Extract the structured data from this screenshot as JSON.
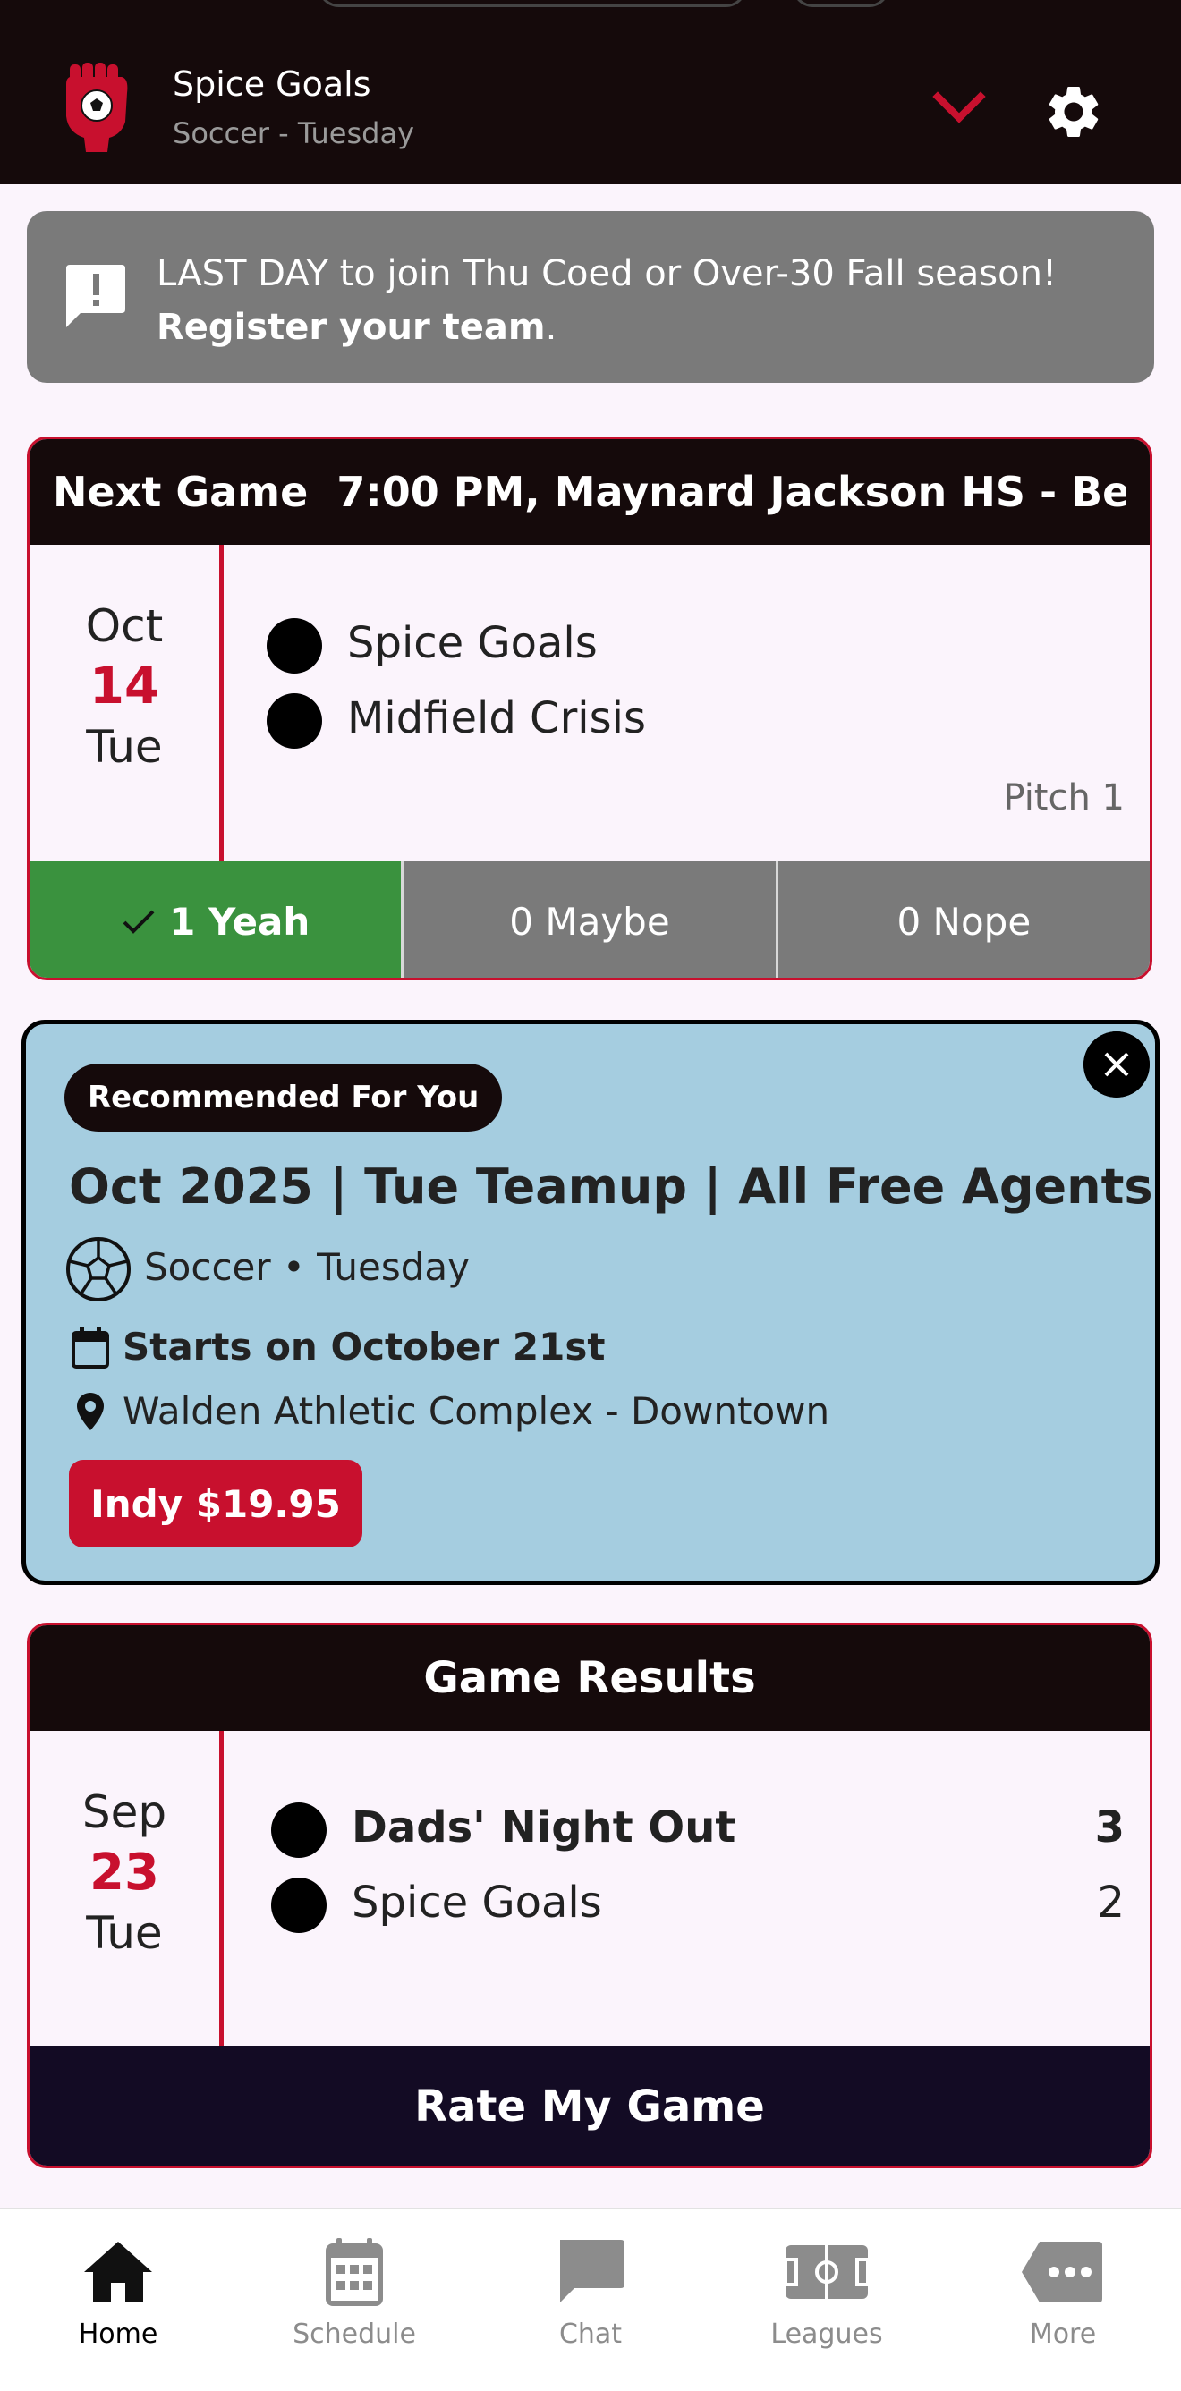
{
  "header": {
    "team_name": "Spice Goals",
    "team_subtitle": "Soccer - Tuesday",
    "logo": "red-fist-soccer-logo",
    "accent_color": "#c8102e"
  },
  "announcement": {
    "text": "LAST DAY to join Thu Coed or Over-30 Fall season! ",
    "link_text": "Register your team",
    "suffix": "."
  },
  "next_game": {
    "label": "Next Game",
    "details": "7:00 PM, Maynard Jackson HS - Be...",
    "month": "Oct",
    "day": "14",
    "weekday": "Tue",
    "teams": [
      "Spice Goals",
      "Midfield Crisis"
    ],
    "pitch": "Pitch 1",
    "rsvp": {
      "yes": "1 Yeah",
      "maybe": "0 Maybe",
      "no": "0 Nope"
    }
  },
  "recommended": {
    "badge": "Recommended For You",
    "title": "Oct 2025 | Tue Teamup | All Free Agents",
    "sport": "Soccer • Tuesday",
    "starts": "Starts on October 21st",
    "venue": "Walden Athletic Complex - Downtown",
    "price": "Indy $19.95",
    "bg_color": "#a5cde0"
  },
  "results": {
    "title": "Game Results",
    "month": "Sep",
    "day": "23",
    "weekday": "Tue",
    "teams": [
      {
        "name": "Dads' Night Out",
        "score": "3"
      },
      {
        "name": "Spice Goals",
        "score": "2"
      }
    ],
    "rate_button": "Rate My Game"
  },
  "nav": {
    "items": [
      {
        "label": "Home",
        "icon": "home-icon",
        "active": true
      },
      {
        "label": "Schedule",
        "icon": "calendar-icon",
        "active": false
      },
      {
        "label": "Chat",
        "icon": "chat-icon",
        "active": false
      },
      {
        "label": "Leagues",
        "icon": "field-icon",
        "active": false
      },
      {
        "label": "More",
        "icon": "more-icon",
        "active": false
      }
    ]
  }
}
